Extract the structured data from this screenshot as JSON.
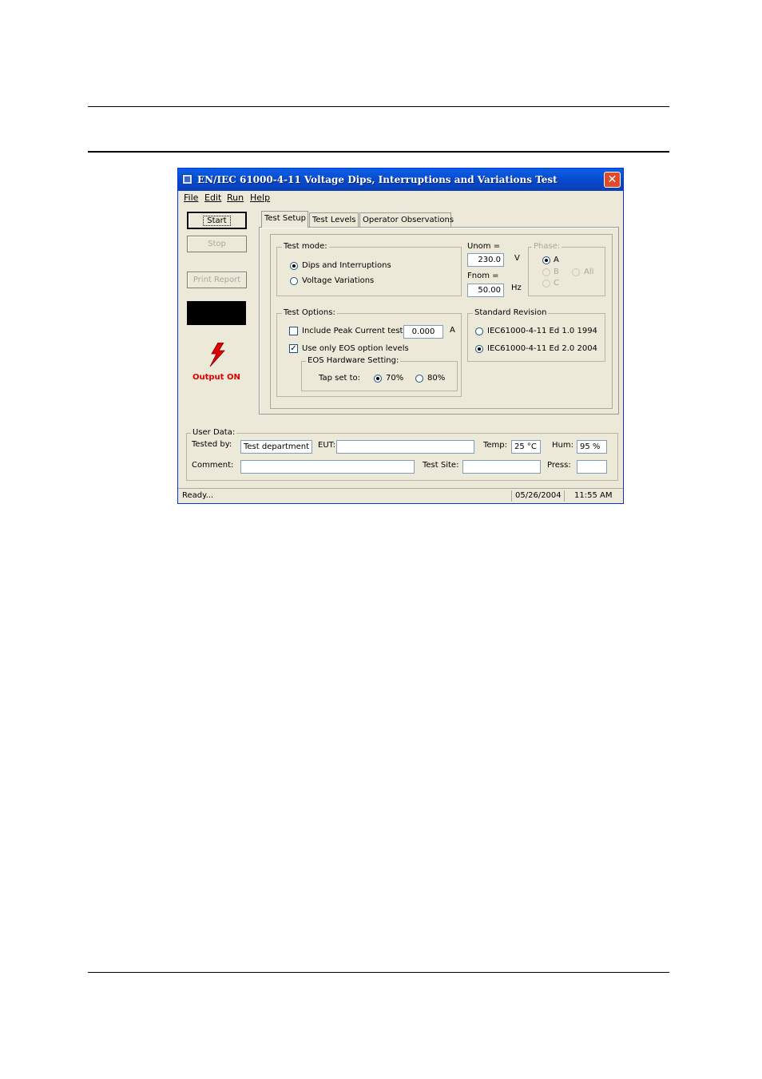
{
  "window": {
    "title": "EN/IEC 61000-4-11 Voltage Dips, Interruptions and Variations Test",
    "close_glyph": "✕"
  },
  "menu": [
    "File",
    "Edit",
    "Run",
    "Help"
  ],
  "buttons": {
    "start": "Start",
    "stop": "Stop",
    "print_report": "Print Report"
  },
  "output_status": "Output ON",
  "colors": {
    "title_bar": "#0a5fe6",
    "output_on": "#e00000",
    "window_bg": "#ece9d8"
  },
  "tabs": [
    "Test Setup",
    "Test Levels",
    "Operator Observations"
  ],
  "active_tab": "Test Setup",
  "test_mode": {
    "label": "Test mode:",
    "options": [
      {
        "label": "Dips and Interruptions",
        "selected": true
      },
      {
        "label": "Voltage Variations",
        "selected": false
      }
    ]
  },
  "unom": {
    "label": "Unom =",
    "value": "230.0",
    "unit": "V"
  },
  "fnom": {
    "label": "Fnom =",
    "value": "50.00",
    "unit": "Hz"
  },
  "phase": {
    "label": "Phase:",
    "options": [
      "A",
      "B",
      "All",
      "C"
    ],
    "selected": "A"
  },
  "test_options": {
    "label": "Test Options:",
    "peak_current": {
      "label": "Include Peak Current test",
      "checked": false,
      "value": "0.000",
      "unit": "A"
    },
    "eos_only": {
      "label": "Use only EOS option levels",
      "checked": true
    },
    "eos_hardware": {
      "label": "EOS Hardware Setting:",
      "tap_label": "Tap set to:",
      "options": [
        {
          "label": "70%",
          "selected": true
        },
        {
          "label": "80%",
          "selected": false
        }
      ]
    }
  },
  "standard_revision": {
    "label": "Standard Revision",
    "options": [
      {
        "label": "IEC61000-4-11 Ed 1.0 1994",
        "selected": false
      },
      {
        "label": "IEC61000-4-11 Ed 2.0 2004",
        "selected": true
      }
    ]
  },
  "user_data": {
    "label": "User Data:",
    "tested_by": {
      "label": "Tested by:",
      "value": "Test department"
    },
    "eut": {
      "label": "EUT:",
      "value": ""
    },
    "temp": {
      "label": "Temp:",
      "value": "25 °C"
    },
    "hum": {
      "label": "Hum:",
      "value": "95 %"
    },
    "comment": {
      "label": "Comment:",
      "value": ""
    },
    "test_site": {
      "label": "Test Site:",
      "value": ""
    },
    "press": {
      "label": "Press:",
      "value": ""
    }
  },
  "status": {
    "text": "Ready...",
    "date": "05/26/2004",
    "time": "11:55 AM"
  }
}
